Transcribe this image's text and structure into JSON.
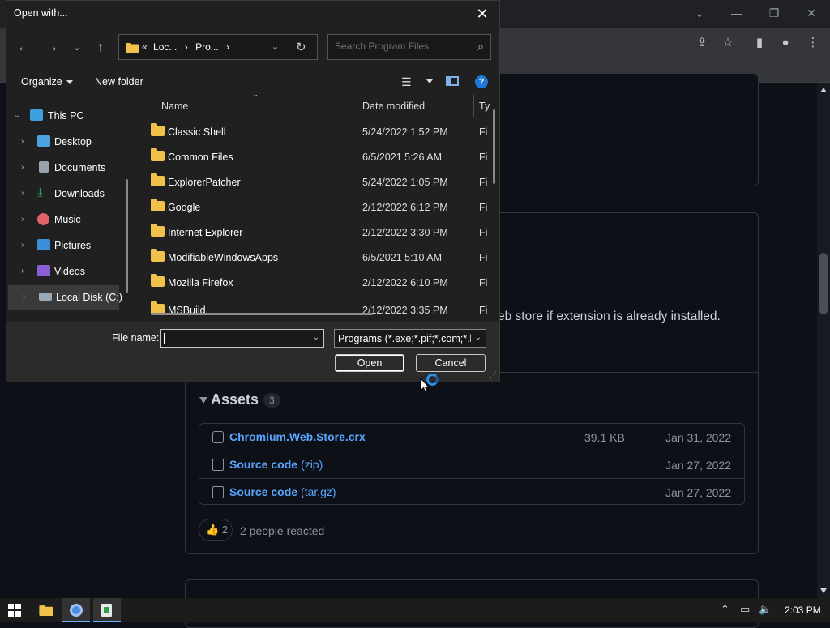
{
  "dialog": {
    "title": "Open with...",
    "address": {
      "crumbs": [
        "«",
        "Loc...",
        "›",
        "Pro...",
        "›"
      ]
    },
    "search_placeholder": "Search Program Files",
    "commands": {
      "organize": "Organize",
      "new_folder": "New folder"
    },
    "nav": [
      {
        "label": "This PC",
        "icon": "pc-icon",
        "expanded": true
      },
      {
        "label": "Desktop",
        "icon": "desktop-icon"
      },
      {
        "label": "Documents",
        "icon": "documents-icon"
      },
      {
        "label": "Downloads",
        "icon": "downloads-icon"
      },
      {
        "label": "Music",
        "icon": "music-icon"
      },
      {
        "label": "Pictures",
        "icon": "pictures-icon"
      },
      {
        "label": "Videos",
        "icon": "videos-icon"
      },
      {
        "label": "Local Disk (C:)",
        "icon": "disk-icon",
        "selected": true
      }
    ],
    "columns": {
      "name": "Name",
      "date": "Date modified",
      "type": "Ty"
    },
    "files": [
      {
        "name": "Classic Shell",
        "date": "5/24/2022 1:52 PM",
        "type": "Fi"
      },
      {
        "name": "Common Files",
        "date": "6/5/2021 5:26 AM",
        "type": "Fi"
      },
      {
        "name": "ExplorerPatcher",
        "date": "5/24/2022 1:05 PM",
        "type": "Fi"
      },
      {
        "name": "Google",
        "date": "2/12/2022 6:12 PM",
        "type": "Fi"
      },
      {
        "name": "Internet Explorer",
        "date": "2/12/2022 3:30 PM",
        "type": "Fi"
      },
      {
        "name": "ModifiableWindowsApps",
        "date": "6/5/2021 5:10 AM",
        "type": "Fi"
      },
      {
        "name": "Mozilla Firefox",
        "date": "2/12/2022 6:10 PM",
        "type": "Fi"
      },
      {
        "name": "MSBuild",
        "date": "2/12/2022 3:35 PM",
        "type": "Fi"
      }
    ],
    "file_name_label": "File name:",
    "file_name_value": "",
    "filter_value": "Programs (*.exe;*.pif;*.com;*.ba",
    "open_label": "Open",
    "cancel_label": "Cancel"
  },
  "page": {
    "release_text": "eb store if extension is already installed.",
    "assets_heading": "Assets",
    "assets_count": "3",
    "assets": [
      {
        "name": "Chromium.Web.Store.crx",
        "ext": "",
        "size": "39.1 KB",
        "date": "Jan 31, 2022"
      },
      {
        "name": "Source code",
        "ext": "(zip)",
        "size": "",
        "date": "Jan 27, 2022"
      },
      {
        "name": "Source code",
        "ext": "(tar.gz)",
        "size": "",
        "date": "Jan 27, 2022"
      }
    ],
    "reaction_emoji": "👍",
    "reaction_count": "2",
    "reactions_text": "2 people reacted"
  },
  "taskbar": {
    "clock": "2:03 PM"
  },
  "colors": {
    "accent_link": "#58a6ff",
    "dialog_bg": "#202020",
    "folder": "#f0c24c"
  }
}
